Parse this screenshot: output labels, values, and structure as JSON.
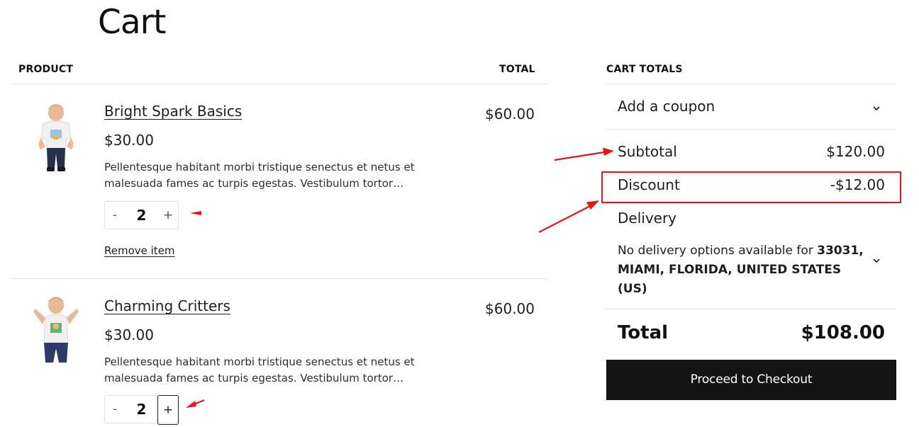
{
  "page": {
    "title": "Cart"
  },
  "cart_table": {
    "product_header": "PRODUCT",
    "total_header": "TOTAL",
    "items": [
      {
        "name": "Bright Spark Basics",
        "price": "$30.00",
        "description": "Pellentesque habitant morbi tristique senectus et netus et malesuada fames ac turpis egestas. Vestibulum tortor…",
        "quantity": "2",
        "line_total": "$60.00",
        "remove_label": "Remove item",
        "minus_label": "-",
        "plus_label": "+"
      },
      {
        "name": "Charming Critters",
        "price": "$30.00",
        "description": "Pellentesque habitant morbi tristique senectus et netus et malesuada fames ac turpis egestas. Vestibulum tortor…",
        "quantity": "2",
        "line_total": "$60.00",
        "minus_label": "-",
        "plus_label": "+"
      }
    ]
  },
  "cart_totals": {
    "header": "CART TOTALS",
    "coupon_label": "Add a coupon",
    "subtotal_label": "Subtotal",
    "subtotal_value": "$120.00",
    "discount_label": "Discount",
    "discount_value": "-$12.00",
    "delivery_label": "Delivery",
    "delivery_note_prefix": "No delivery options available for ",
    "delivery_note_location": "33031, MIAMI, FLORIDA, UNITED STATES (US)",
    "total_label": "Total",
    "total_value": "$108.00",
    "checkout_label": "Proceed to Checkout"
  },
  "icons": {
    "coupon_toggle": "chevron-down-icon",
    "delivery_toggle": "chevron-down-icon",
    "product_images": [
      "kid-tshirt-image",
      "kid-tshirt-image"
    ]
  },
  "colors": {
    "annotation_red": "#e8141b",
    "checkout_button": "#141414"
  }
}
